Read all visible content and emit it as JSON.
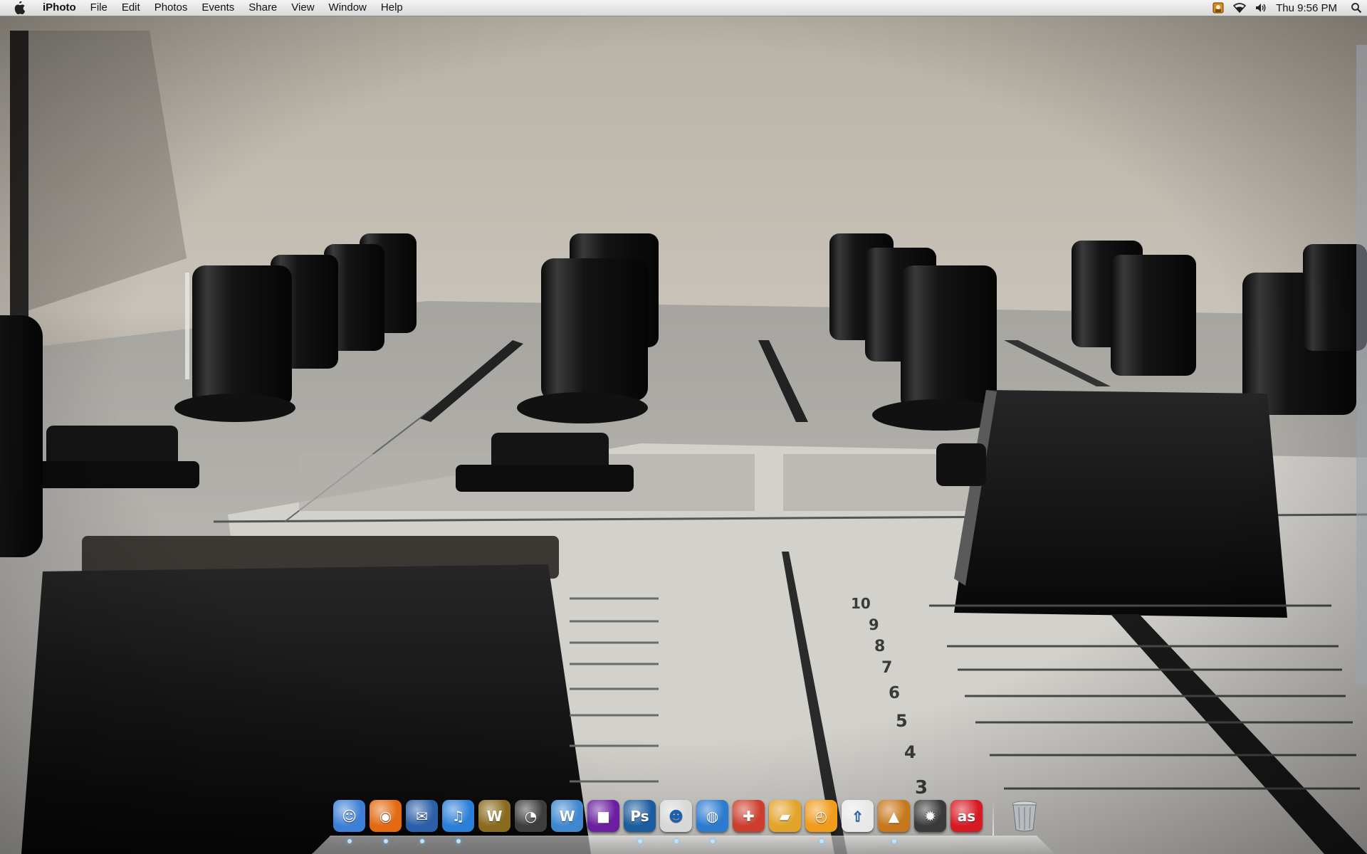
{
  "menubar": {
    "apple_icon": "apple-logo-icon",
    "app_name": "iPhoto",
    "items": [
      "File",
      "Edit",
      "Photos",
      "Events",
      "Share",
      "View",
      "Window",
      "Help"
    ],
    "status_icons": [
      "photo-app-status-icon",
      "wifi-icon",
      "volume-icon"
    ],
    "clock": "Thu 9:56 PM",
    "spotlight_icon": "spotlight-search-icon"
  },
  "photo": {
    "subject": "mixer",
    "fader_scale": [
      "10",
      "9",
      "8",
      "7",
      "6",
      "5",
      "4",
      "3"
    ]
  },
  "dock": {
    "apps": [
      {
        "name": "Finder",
        "icon": "finder-icon",
        "color": "#3d7fd6",
        "glyph": "☺",
        "running": true
      },
      {
        "name": "Firefox",
        "icon": "firefox-icon",
        "color": "#e36a12",
        "glyph": "◉",
        "running": true
      },
      {
        "name": "Thunderbird",
        "icon": "thunderbird-icon",
        "color": "#2c5fa8",
        "glyph": "✉",
        "running": true
      },
      {
        "name": "iTunes",
        "icon": "itunes-icon",
        "color": "#2b7fd8",
        "glyph": "♫",
        "running": true
      },
      {
        "name": "World of Warcraft",
        "icon": "wow-icon",
        "color": "#8a6a1e",
        "glyph": "W",
        "running": false
      },
      {
        "name": "Adium",
        "icon": "adium-duck-icon",
        "color": "#3d3d3d",
        "glyph": "◔",
        "running": false
      },
      {
        "name": "Word",
        "icon": "word-icon",
        "color": "#3f87cf",
        "glyph": "W",
        "running": false
      },
      {
        "name": "Application",
        "icon": "purple-app-icon",
        "color": "#6b1fa0",
        "glyph": "■",
        "running": false
      },
      {
        "name": "Photoshop",
        "icon": "photoshop-icon",
        "color": "#1b5c9e",
        "glyph": "Ps",
        "running": true
      },
      {
        "name": "Chat",
        "icon": "chat-helmet-icon",
        "color": "#d8d8d8",
        "glyph": "☻",
        "running": true
      },
      {
        "name": "Network",
        "icon": "globe-icon",
        "color": "#2d7bd0",
        "glyph": "◍",
        "running": true
      },
      {
        "name": "Utility",
        "icon": "joystick-icon",
        "color": "#cc3d2c",
        "glyph": "✚",
        "running": false
      },
      {
        "name": "Transmit",
        "icon": "transmit-truck-icon",
        "color": "#e2a42a",
        "glyph": "▰",
        "running": false
      },
      {
        "name": "Timer",
        "icon": "orange-timer-icon",
        "color": "#f19b1b",
        "glyph": "◴",
        "running": true
      },
      {
        "name": "Flickr Uploadr",
        "icon": "flickr-uploader-icon",
        "color": "#e8e8e8",
        "glyph": "⇧",
        "running": false
      },
      {
        "name": "iPhoto",
        "icon": "iphoto-icon",
        "color": "#c8781c",
        "glyph": "▲",
        "running": true
      },
      {
        "name": "Burn",
        "icon": "burn-icon",
        "color": "#3a3a3a",
        "glyph": "✹",
        "running": false
      },
      {
        "name": "Last.fm",
        "icon": "lastfm-icon",
        "color": "#d61a23",
        "glyph": "as",
        "running": false
      }
    ],
    "trash_icon": "trash-icon"
  }
}
